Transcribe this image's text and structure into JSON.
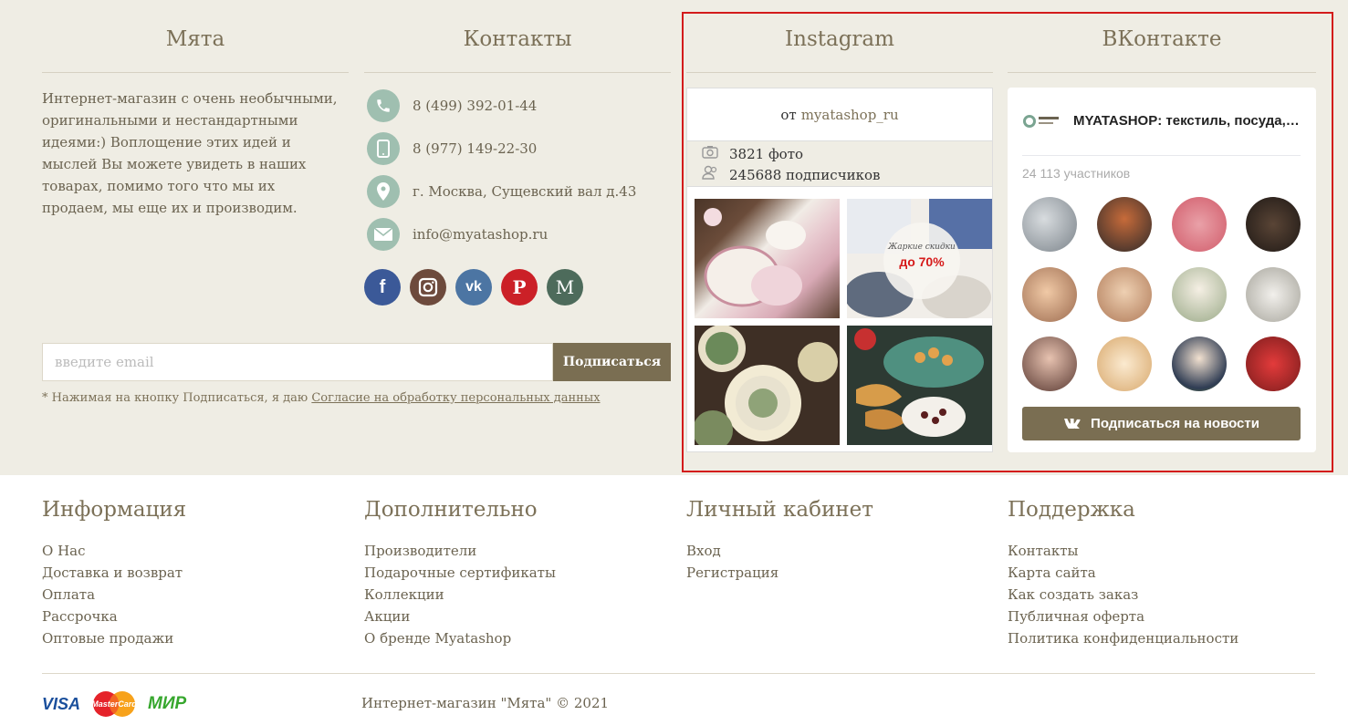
{
  "about": {
    "title": "Мята",
    "text": "Интернет-магазин с очень необычными, оригинальными и нестандартными идеями:) Воплощение этих идей и мыслей Вы можете увидеть в наших товарах, помимо того что мы их продаем, мы еще их и производим."
  },
  "contacts": {
    "title": "Контакты",
    "items": [
      {
        "icon": "phone-icon",
        "text": "8 (499) 392-01-44"
      },
      {
        "icon": "mobile-icon",
        "text": "8 (977) 149-22-30"
      },
      {
        "icon": "location-icon",
        "text": "г. Москва, Сущевский вал д.43"
      },
      {
        "icon": "envelope-icon",
        "text": "info@myatashop.ru"
      }
    ],
    "social": [
      {
        "name": "facebook-icon",
        "glyph": "f",
        "color": "#3b5998"
      },
      {
        "name": "instagram-icon",
        "glyph": "◙",
        "color": "#6d4a3c"
      },
      {
        "name": "vk-icon",
        "glyph": "vk",
        "color": "#4c75a3"
      },
      {
        "name": "pinterest-icon",
        "glyph": "P",
        "color": "#cb2027"
      },
      {
        "name": "livemaster-icon",
        "glyph": "M",
        "color": "#4d6b5b"
      }
    ]
  },
  "subscribe": {
    "placeholder": "введите email",
    "button": "Подписаться",
    "consent_prefix": "* Нажимая на кнопку Подписаться, я даю ",
    "consent_link": "Согласие на обработку персональных данных"
  },
  "instagram": {
    "title": "Instagram",
    "from": "от",
    "handle": "myatashop_ru",
    "photos_count": "3821 фото",
    "followers": "245688 подписчиков",
    "promo_script": "Жаркие скидки",
    "promo_big": "до 70%"
  },
  "vk": {
    "title": "ВКонтакте",
    "group_name": "MYATASHOP: текстиль, посуда, декор",
    "members": "24 113 участников",
    "button": "Подписаться на новости"
  },
  "footer": {
    "columns": [
      {
        "title": "Информация",
        "items": [
          "О Нас",
          "Доставка и возврат",
          "Оплата",
          "Рассрочка",
          "Оптовые продажи"
        ]
      },
      {
        "title": "Дополнительно",
        "items": [
          "Производители",
          "Подарочные сертификаты",
          "Коллекции",
          "Акции",
          "О бренде Myatashop"
        ]
      },
      {
        "title": "Личный кабинет",
        "items": [
          "Вход",
          "Регистрация"
        ]
      },
      {
        "title": "Поддержка",
        "items": [
          "Контакты",
          "Карта сайта",
          "Как создать заказ",
          "Публичная оферта",
          "Политика конфиденциальности"
        ]
      }
    ],
    "payments": [
      "VISA",
      "MasterCard",
      "МИР"
    ],
    "copyright": "Интернет-магазин \"Мята\" © 2021"
  },
  "colors": {
    "background_top": "#efede4",
    "accent": "#7a6e52",
    "icon_circle": "#9fbfb0",
    "highlight_border": "#d31b1b"
  }
}
